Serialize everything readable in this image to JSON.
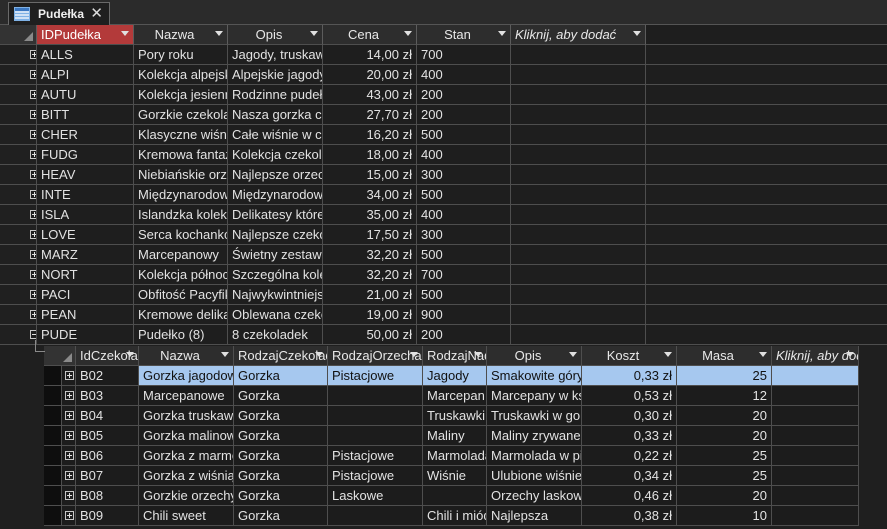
{
  "tab": {
    "title": "Pudełka",
    "close": "✕"
  },
  "main": {
    "columns": [
      {
        "label": "IDPudełka",
        "w": 97
      },
      {
        "label": "Nazwa",
        "w": 94
      },
      {
        "label": "Opis",
        "w": 95
      },
      {
        "label": "Cena",
        "w": 94
      },
      {
        "label": "Stan",
        "w": 94
      },
      {
        "label": "Kliknij, aby dodać",
        "w": 135
      }
    ],
    "rows": [
      [
        "ALLS",
        "Pory roku",
        "Jagody, truskawki",
        "14,00 zł",
        "700"
      ],
      [
        "ALPI",
        "Kolekcja alpejska",
        "Alpejskie jagody",
        "20,00 zł",
        "400"
      ],
      [
        "AUTU",
        "Kolekcja jesienna",
        "Rodzinne pudełko",
        "43,00 zł",
        "200"
      ],
      [
        "BITT",
        "Gorzkie czekolady",
        "Nasza gorzka czekolada",
        "27,70 zł",
        "200"
      ],
      [
        "CHER",
        "Klasyczne wiśnie",
        "Całe wiśnie w czekoladzie",
        "16,20 zł",
        "500"
      ],
      [
        "FUDG",
        "Kremowa fantazja",
        "Kolekcja czekoladek",
        "18,00 zł",
        "400"
      ],
      [
        "HEAV",
        "Niebiańskie orzechy",
        "Najlepsze orzechy",
        "15,00 zł",
        "300"
      ],
      [
        "INTE",
        "Międzynarodowa",
        "Międzynarodowe smaki",
        "34,00 zł",
        "500"
      ],
      [
        "ISLA",
        "Islandzka kolekcja",
        "Delikatesy które",
        "35,00 zł",
        "400"
      ],
      [
        "LOVE",
        "Serca kochanków",
        "Najlepsze czekoladki",
        "17,50 zł",
        "300"
      ],
      [
        "MARZ",
        "Marcepanowy",
        "Świetny zestaw",
        "32,20 zł",
        "500"
      ],
      [
        "NORT",
        "Kolekcja północna",
        "Szczególna kolekcja",
        "32,20 zł",
        "700"
      ],
      [
        "PACI",
        "Obfitość Pacyfiku",
        "Najwykwintniejsze",
        "21,00 zł",
        "500"
      ],
      [
        "PEAN",
        "Kremowe delikatesy",
        "Oblewana czekoladą",
        "19,00 zł",
        "900"
      ],
      [
        "PUDE",
        "Pudełko (8)",
        "8 czekoladek",
        "50,00 zł",
        "200"
      ]
    ]
  },
  "sub": {
    "columns": [
      {
        "label": "IdCzekoladki",
        "w": 95
      },
      {
        "label": "Nazwa",
        "w": 95
      },
      {
        "label": "RodzajCzekolady",
        "w": 94
      },
      {
        "label": "RodzajOrzecha",
        "w": 95
      },
      {
        "label": "RodzajNadzienia",
        "w": 64
      },
      {
        "label": "Opis",
        "w": 95
      },
      {
        "label": "Koszt",
        "w": 95
      },
      {
        "label": "Masa",
        "w": 95
      },
      {
        "label": "Kliknij, aby dodać",
        "w": 87
      }
    ],
    "rows": [
      [
        "B02",
        "Gorzka jagodowa",
        "Gorzka",
        "Pistacjowe",
        "Jagody",
        "Smakowite góry",
        "0,33 zł",
        "25"
      ],
      [
        "B03",
        "Marcepanowe",
        "Gorzka",
        "",
        "Marcepan",
        "Marcepany w kształcie",
        "0,53 zł",
        "12"
      ],
      [
        "B04",
        "Gorzka truskawkowa",
        "Gorzka",
        "",
        "Truskawki",
        "Truskawki w gorzkiej",
        "0,30 zł",
        "20"
      ],
      [
        "B05",
        "Gorzka malinowa",
        "Gorzka",
        "",
        "Maliny",
        "Maliny zrywane",
        "0,33 zł",
        "20"
      ],
      [
        "B06",
        "Gorzka z marmoladą",
        "Gorzka",
        "Pistacjowe",
        "Marmolada",
        "Marmolada w pistacjach",
        "0,22 zł",
        "25"
      ],
      [
        "B07",
        "Gorzka z wiśnią",
        "Gorzka",
        "Pistacjowe",
        "Wiśnie",
        "Ulubione wiśnie",
        "0,34 zł",
        "25"
      ],
      [
        "B08",
        "Gorzkie orzechy",
        "Gorzka",
        "Laskowe",
        "",
        "Orzechy laskowe",
        "0,46 zł",
        "20"
      ],
      [
        "B09",
        "Chili sweet",
        "Gorzka",
        "",
        "Chili i miód",
        "Najlepsza",
        "0,38 zł",
        "10"
      ]
    ]
  }
}
